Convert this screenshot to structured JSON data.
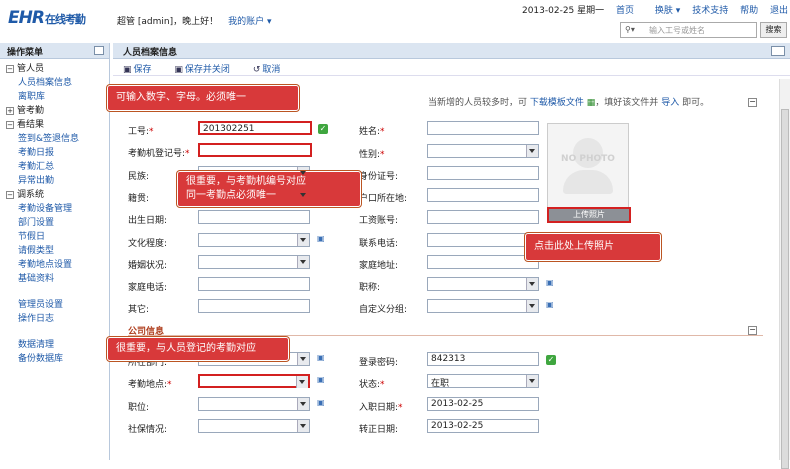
{
  "header": {
    "logo": "EHR",
    "logo_sub": "在线考勤",
    "greeting": "超管 [admin]，晚上好！",
    "account_menu": "我的账户",
    "date": "2013-02-25 星期一",
    "nav": [
      "首页",
      "换肤",
      "技术支持",
      "帮助",
      "退出"
    ],
    "search_placeholder": "输入工号或姓名",
    "search_button": "搜索"
  },
  "sidebar": {
    "title": "操作菜单",
    "groups": [
      {
        "label": "管人员",
        "items": [
          "人员档案信息",
          "离职库"
        ]
      },
      {
        "label": "管考勤",
        "items": []
      },
      {
        "label": "看结果",
        "items": [
          "签到&签退信息",
          "考勤日报",
          "考勤汇总",
          "异常出勤"
        ]
      },
      {
        "label": "调系统",
        "items": [
          "考勤设备管理",
          "部门设置",
          "节假日",
          "请假类型",
          "考勤地点设置",
          "基础资料"
        ]
      }
    ],
    "extra": [
      "管理员设置",
      "操作日志",
      "数据清理",
      "备份数据库"
    ]
  },
  "main": {
    "title": "人员档案信息",
    "toolbar": {
      "save": "保存",
      "save_close": "保存并关闭",
      "cancel": "取消"
    },
    "hint": {
      "pre": "当新增的人员较多时，可",
      "link1": "下载模板文件",
      "mid": "，填好该文件并",
      "link2": "导入",
      "post": "即可。"
    },
    "fields": {
      "emp_no": {
        "label": "工号:",
        "value": "201302251"
      },
      "machine_no": {
        "label": "考勤机登记号:"
      },
      "ethnic": {
        "label": "民族:"
      },
      "native": {
        "label": "籍贯:"
      },
      "birth": {
        "label": "出生日期:"
      },
      "edu": {
        "label": "文化程度:"
      },
      "marital": {
        "label": "婚姻状况:"
      },
      "home_phone": {
        "label": "家庭电话:"
      },
      "other": {
        "label": "其它:"
      },
      "name": {
        "label": "姓名:"
      },
      "gender": {
        "label": "性别:"
      },
      "id_no": {
        "label": "身份证号:"
      },
      "hukou": {
        "label": "户口所在地:"
      },
      "salary_acct": {
        "label": "工资账号:"
      },
      "phone": {
        "label": "联系电话:"
      },
      "address": {
        "label": "家庭地址:"
      },
      "title": {
        "label": "职称:"
      },
      "custom_group": {
        "label": "自定义分组:"
      }
    },
    "company_section": "公司信息",
    "company": {
      "dept": {
        "label": "所在部门:"
      },
      "location": {
        "label": "考勤地点:"
      },
      "position": {
        "label": "职位:"
      },
      "social": {
        "label": "社保情况:"
      },
      "password": {
        "label": "登录密码:",
        "value": "842313"
      },
      "status": {
        "label": "状态:",
        "value": "在职"
      },
      "hire_date": {
        "label": "入职日期:",
        "value": "2013-02-25"
      },
      "regular_date": {
        "label": "转正日期:",
        "value": "2013-02-25"
      }
    },
    "photo_text": "NO PHOTO",
    "upload_button": "上传照片"
  },
  "callouts": {
    "c1": "可输入数字、字母。必须唯一",
    "c2a": "很重要，与考勤机编号对应",
    "c2b": "同一考勤点必须唯一",
    "c3": "点击此处上传照片",
    "c4": "很重要，与人员登记的考勤对应"
  },
  "required_mark": "*"
}
